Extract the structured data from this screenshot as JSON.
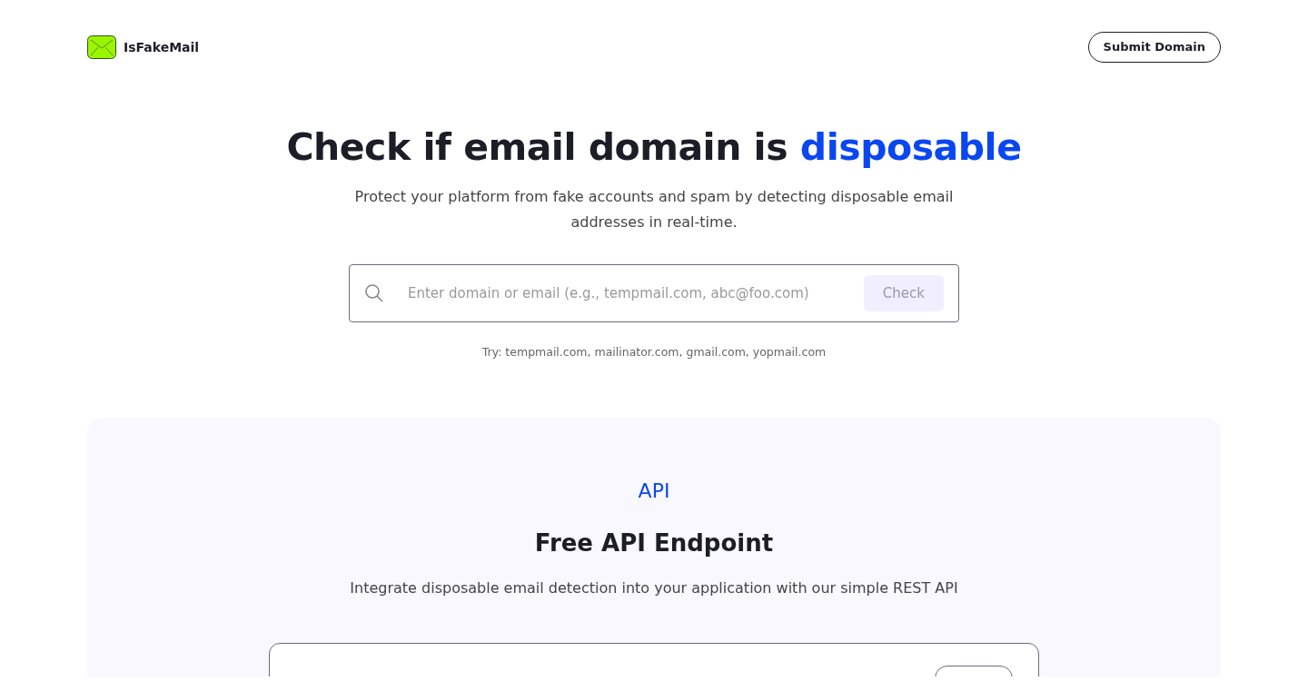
{
  "header": {
    "brand": "IsFakeMail",
    "submit_button": "Submit Domain"
  },
  "hero": {
    "title_parts": [
      {
        "text": "Check if email domain is ",
        "highlight": false
      },
      {
        "text": "disposable",
        "highlight": true
      }
    ],
    "subtitle": "Protect your platform from fake accounts and spam by detecting disposable email addresses in real-time.",
    "search": {
      "placeholder": "Enter domain or email (e.g., tempmail.com, abc@foo.com)",
      "button": "Check",
      "button_disabled": true
    },
    "examples": "Try: tempmail.com, mailinator.com, gmail.com, yopmail.com"
  },
  "api_section": {
    "tag": "API",
    "title": "Free API Endpoint",
    "description": "Integrate disposable email detection into your application with our simple REST API"
  }
}
